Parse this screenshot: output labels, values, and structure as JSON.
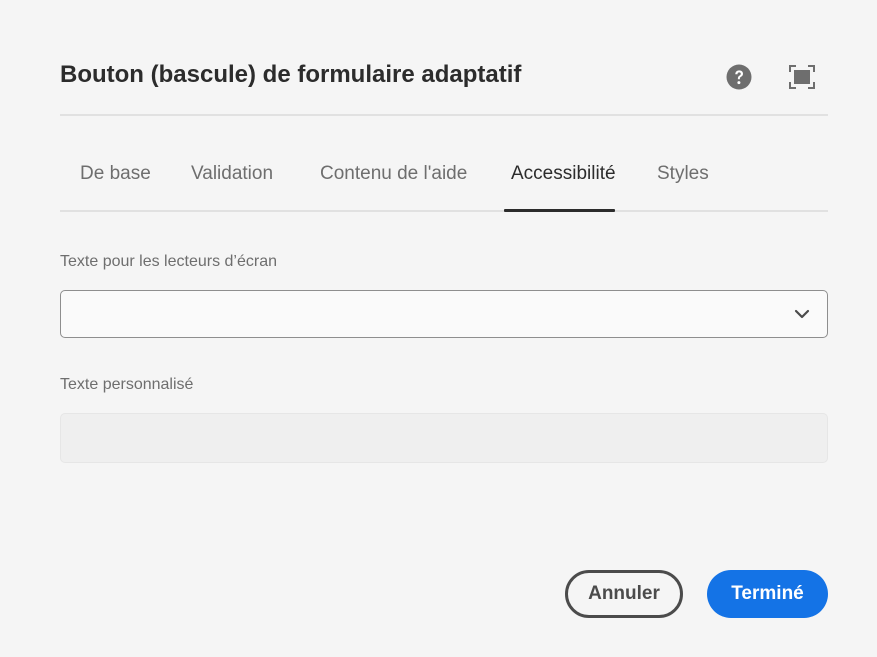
{
  "dialog": {
    "title": "Bouton (bascule) de formulaire adaptatif",
    "help_icon": "help-icon",
    "fullscreen_icon": "fullscreen-icon"
  },
  "tabs": [
    {
      "label": "De base",
      "selected": false
    },
    {
      "label": "Validation",
      "selected": false
    },
    {
      "label": "Contenu de l'aide",
      "selected": false
    },
    {
      "label": "Accessibilité",
      "selected": true
    },
    {
      "label": "Styles",
      "selected": false
    }
  ],
  "form": {
    "screen_reader": {
      "label": "Texte pour les lecteurs d’écran",
      "value": ""
    },
    "custom_text": {
      "label": "Texte personnalisé",
      "value": ""
    }
  },
  "footer": {
    "cancel_label": "Annuler",
    "done_label": "Terminé"
  },
  "colors": {
    "accent": "#1473e6",
    "background": "#f5f5f5",
    "text": "#2c2c2c"
  }
}
